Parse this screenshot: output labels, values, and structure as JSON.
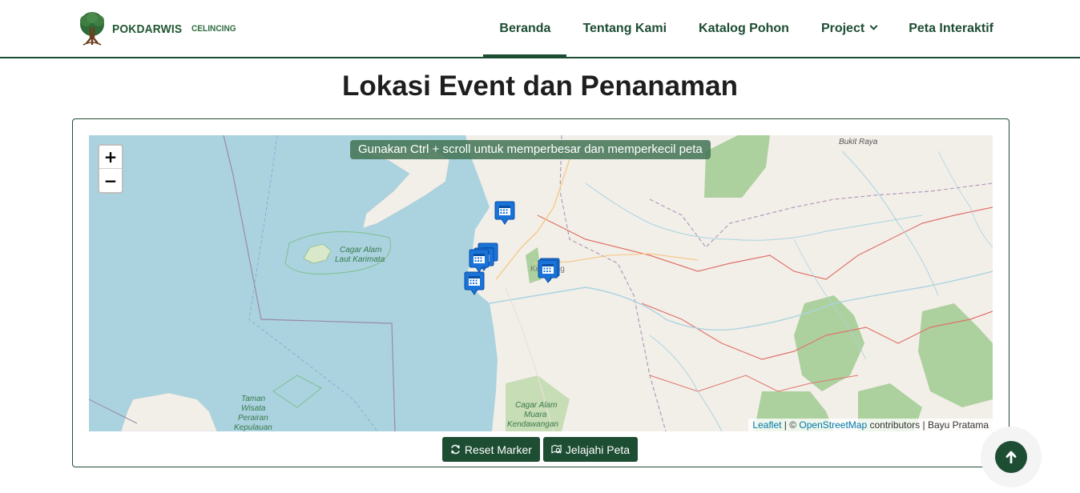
{
  "brand": {
    "name": "POKDARWIS",
    "sub": "CELINCING",
    "logo_icon": "tree-logo-icon"
  },
  "nav": {
    "items": [
      {
        "label": "Beranda",
        "active": true
      },
      {
        "label": "Tentang Kami",
        "active": false
      },
      {
        "label": "Katalog Pohon",
        "active": false
      },
      {
        "label": "Project",
        "active": false,
        "dropdown": true
      },
      {
        "label": "Peta Interaktif",
        "active": false
      }
    ]
  },
  "page": {
    "title": "Lokasi Event dan Penanaman"
  },
  "map": {
    "hint": "Gunakan Ctrl + scroll untuk memperbesar dan memperkecil peta",
    "zoom_in": "+",
    "zoom_out": "−",
    "labels": {
      "bukit_raya": "Bukit Raya",
      "cagar_karimata_1": "Cagar Alam",
      "cagar_karimata_2": "Laut Karimata",
      "ketapang": "Ketapang",
      "taman_1": "Taman",
      "taman_2": "Wisata",
      "taman_3": "Perairan",
      "taman_4": "Kepulauan",
      "muara_1": "Cagar Alam",
      "muara_2": "Muara",
      "muara_3": "Kendawangan"
    },
    "marker_icon": "calendar-icon",
    "attribution": {
      "leaflet": "Leaflet",
      "sep": " | © ",
      "osm": "OpenStreetMap",
      "rest": " contributors | Bayu Pratama"
    },
    "colors": {
      "water": "#aad3df",
      "land": "#f2efe9",
      "forest": "#add19e",
      "boundary": "#e0736a"
    }
  },
  "buttons": {
    "reset": {
      "label": "Reset Marker",
      "icon": "refresh-icon"
    },
    "explore": {
      "label": "Jelajahi Peta",
      "icon": "map-search-icon"
    }
  },
  "scroll_top": {
    "icon": "arrow-up-icon"
  },
  "theme": {
    "primary": "#1d4d33"
  }
}
